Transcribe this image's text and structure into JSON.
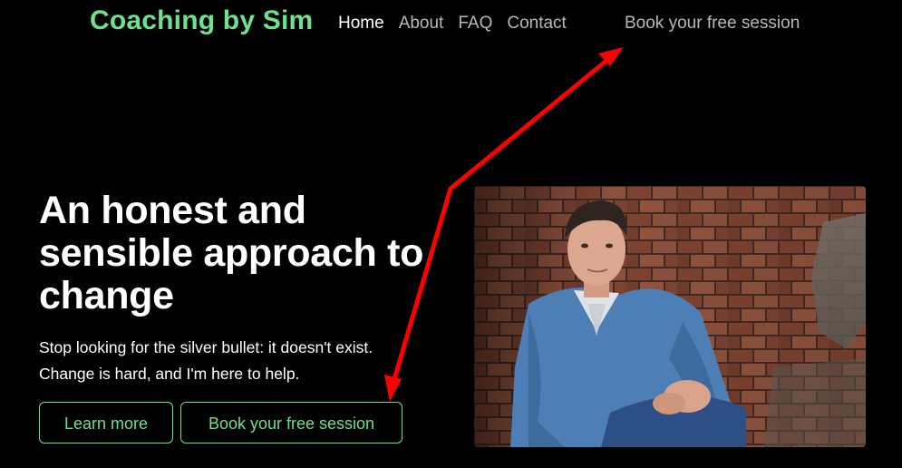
{
  "header": {
    "brand": "Coaching by Sim",
    "nav": [
      {
        "label": "Home",
        "active": true
      },
      {
        "label": "About",
        "active": false
      },
      {
        "label": "FAQ",
        "active": false
      },
      {
        "label": "Contact",
        "active": false
      }
    ],
    "cta_label": "Book your free session"
  },
  "hero": {
    "title": "An honest and sensible approach to change",
    "subtitle_line1": "Stop looking for the silver bullet: it doesn't exist.",
    "subtitle_line2": "Change is hard, and I'm here to help.",
    "learn_more_label": "Learn more",
    "book_label": "Book your free session"
  },
  "colors": {
    "background": "#000000",
    "accent": "#6ee18f",
    "nav_inactive": "#b7b7b7",
    "annotation_arrow": "#ff0000"
  },
  "icons": {
    "annotation": "arrow-icon",
    "photo": "portrait-photo"
  }
}
